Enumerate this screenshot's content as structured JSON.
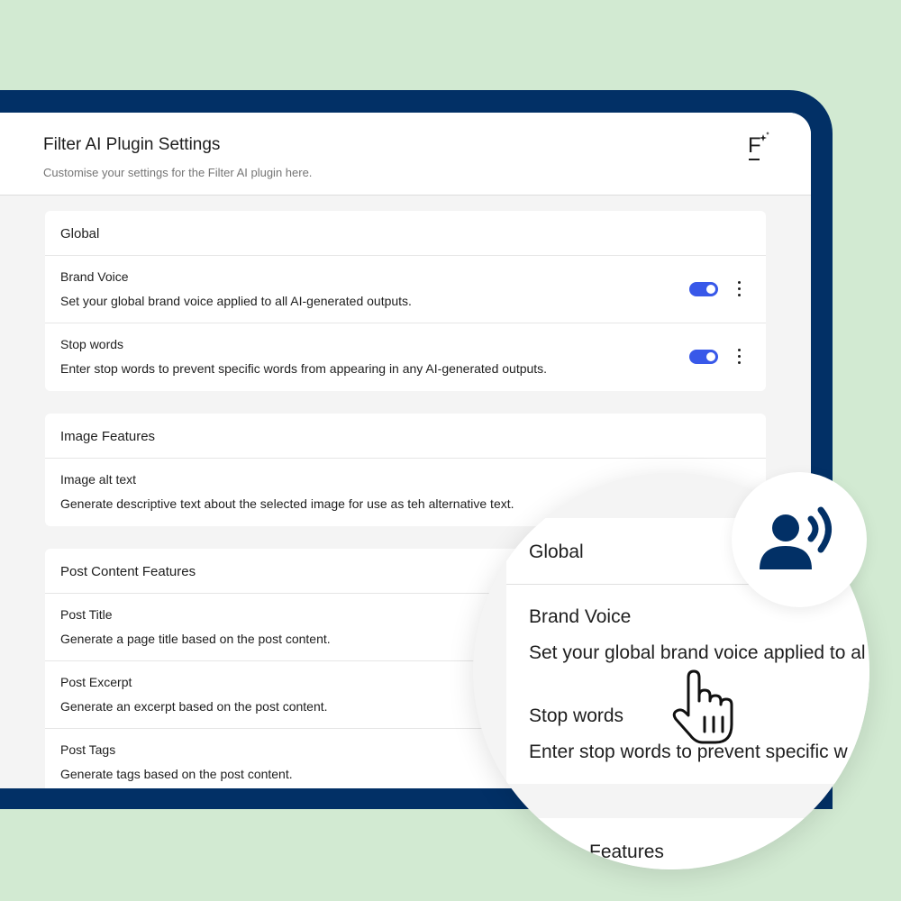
{
  "header": {
    "title": "Filter AI Plugin Settings",
    "subtitle": "Customise your settings for the Filter AI plugin here.",
    "logo_letter": "F"
  },
  "cards": {
    "global": {
      "title": "Global",
      "rows": [
        {
          "title": "Brand Voice",
          "desc": "Set your global brand voice applied to all AI-generated outputs.",
          "enabled": true
        },
        {
          "title": "Stop words",
          "desc": "Enter stop words to prevent specific words from appearing in any AI-generated outputs.",
          "enabled": true
        }
      ]
    },
    "image": {
      "title": "Image Features",
      "rows": [
        {
          "title": "Image alt text",
          "desc": "Generate descriptive text about the selected image for use as teh alternative text."
        }
      ]
    },
    "post": {
      "title": "Post Content Features",
      "rows": [
        {
          "title": "Post Title",
          "desc": "Generate a page title based on the post content."
        },
        {
          "title": "Post Excerpt",
          "desc": "Generate an excerpt based on the post content."
        },
        {
          "title": "Post Tags",
          "desc": "Generate tags based on the post content."
        }
      ]
    }
  },
  "magnifier": {
    "head": "Global",
    "row1_title": "Brand Voice",
    "row1_desc": "Set your global brand voice applied to al",
    "row2_title": "Stop words",
    "row2_desc": "Enter stop words to prevent specific w",
    "next_head": "Features"
  },
  "icons": {
    "logo": "filter-logo-icon",
    "voice": "voice-user-icon",
    "cursor": "hand-pointer-icon",
    "menu": "more-vertical-icon"
  },
  "colors": {
    "background": "#d2ead2",
    "device_frame": "#023066",
    "toggle_on": "#3858e9",
    "voice_icon": "#023066"
  }
}
